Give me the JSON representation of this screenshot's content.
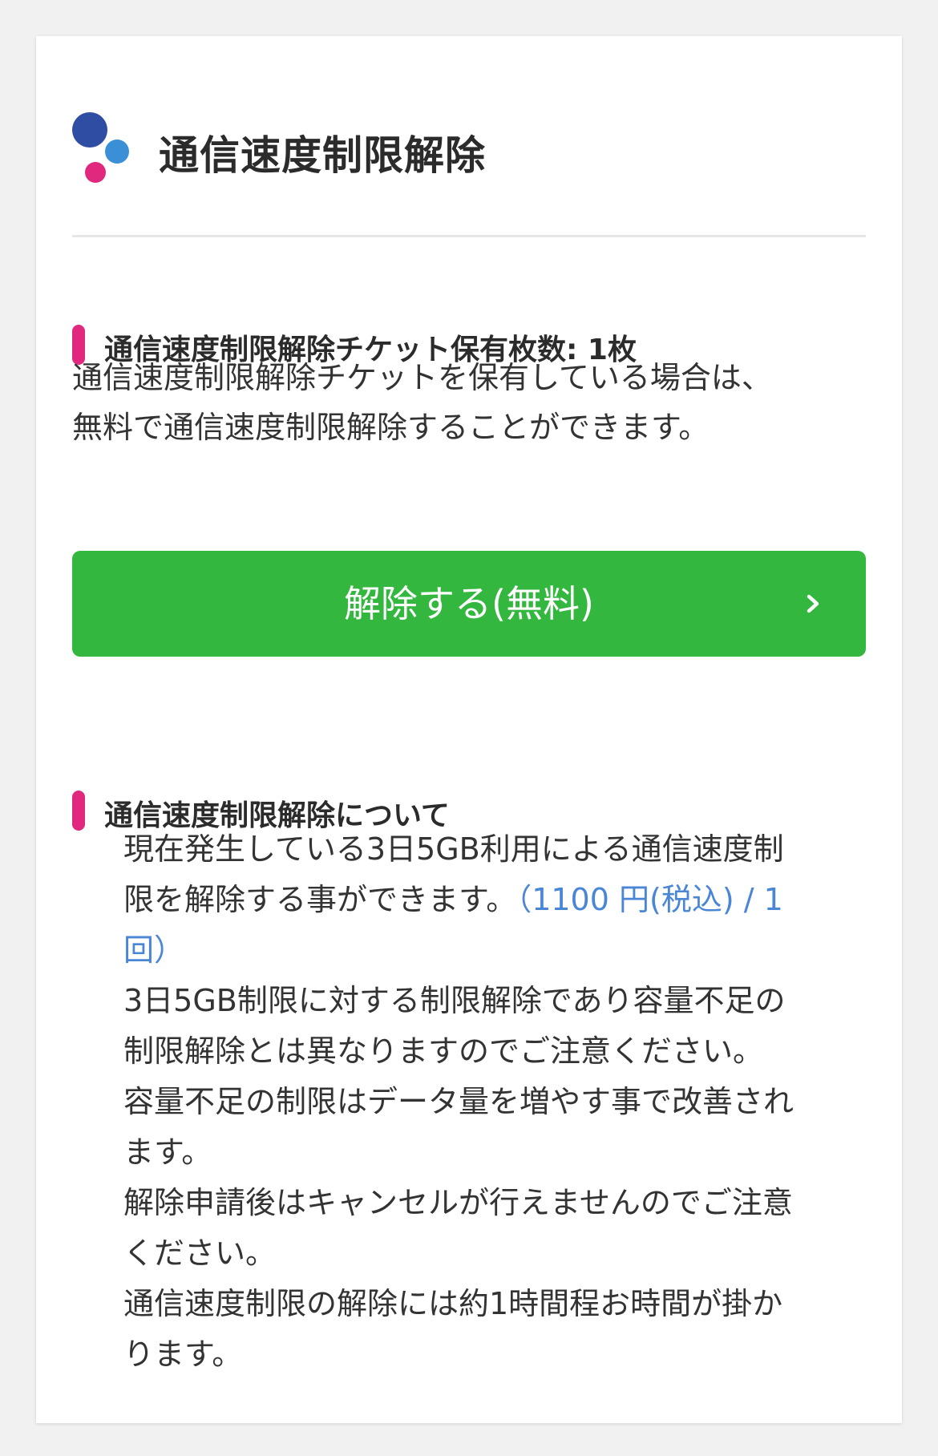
{
  "header": {
    "title": "通信速度制限解除",
    "logo_icon": "three-dots-logo-icon"
  },
  "ticket_section": {
    "heading": "通信速度制限解除チケット保有枚数: 1枚",
    "description_lines": [
      "通信速度制限解除チケットを保有している場合は、",
      "無料で通信速度制限解除することができます。"
    ]
  },
  "release_button": {
    "label": "解除する(無料)",
    "icon": "chevron-right-icon"
  },
  "about_section": {
    "heading": "通信速度制限解除について",
    "line1": "現在発生している3日5GB利用による通信速度制",
    "line2_text": "限を解除する事ができます。",
    "price_part1": "（1100 円(税込) / 1",
    "price_part2": "回）",
    "lines_rest": [
      "3日5GB制限に対する制限解除であり容量不足の",
      "制限解除とは異なりますのでご注意ください。",
      "容量不足の制限はデータ量を増やす事で改善され",
      "ます。",
      "解除申請後はキャンセルが行えませんのでご注意",
      "ください。",
      "通信速度制限の解除には約1時間程お時間が掛か",
      "ります。"
    ]
  },
  "colors": {
    "accent_pink": "#e0287f",
    "button_green": "#33b73f",
    "link_blue": "#4a86d6",
    "logo_navy": "#2f4da3",
    "logo_blue": "#3b8fd6"
  }
}
